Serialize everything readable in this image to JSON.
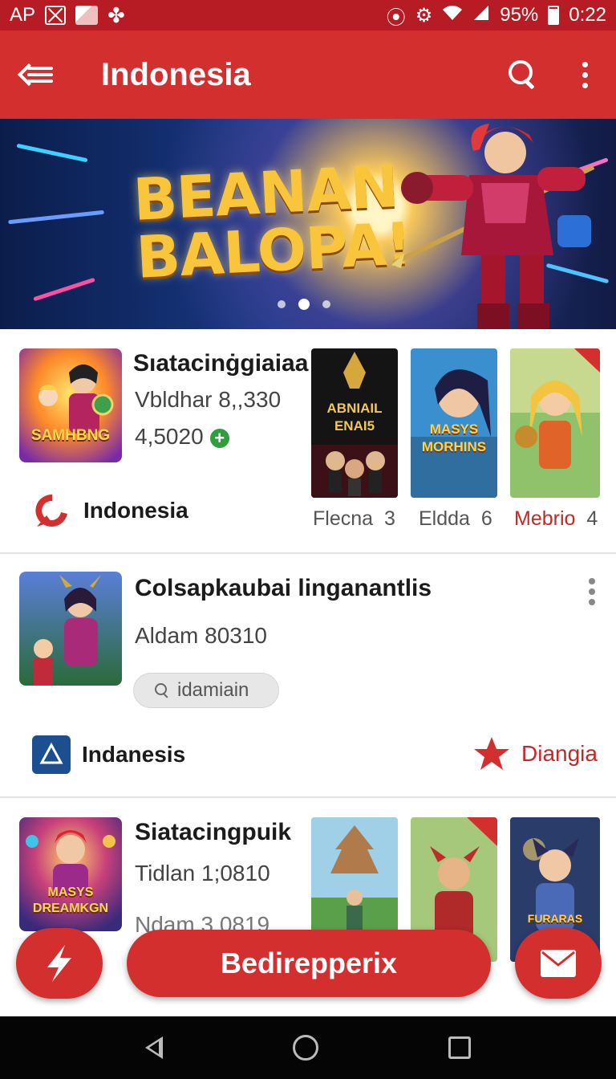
{
  "status_bar": {
    "carrier": "AP",
    "battery": "95%",
    "time": "0:22"
  },
  "app_bar": {
    "title": "Indonesia"
  },
  "banner": {
    "line1": "BEANAN",
    "line2": "BALOPA!",
    "dots": 3,
    "active_dot": 1
  },
  "cards": [
    {
      "thumb_text": "SAMHBNG",
      "name": "Sıatacinġgiaiaa",
      "line1": "Vbldhar 8,,330",
      "line2": "4,5020",
      "brand": "Indonesia",
      "posters": [
        {
          "art_text_1": "ABNIAIL",
          "art_text_2": "ENAI5",
          "label": "Flecna",
          "count": "3"
        },
        {
          "art_text_1": "MASYS",
          "art_text_2": "MORHINS",
          "label": "Eldda",
          "count": "6"
        },
        {
          "art_text_1": "",
          "art_text_2": "",
          "label": "Mebrio",
          "count": "4"
        }
      ]
    },
    {
      "name": "Colsapkaubai linganantlis",
      "line1": "Aldam 80310",
      "chip": "idamiain",
      "brand": "Indanesis",
      "rating_label": "Diangia"
    },
    {
      "thumb_text_1": "MASYS",
      "thumb_text_2": "DREAMKGN",
      "name": "Siatacingpuik",
      "line1": "Tidlan 1;0810",
      "line2": "Ndam 3,0819",
      "posters": [
        {
          "art_text": ""
        },
        {
          "art_text": ""
        },
        {
          "art_text": "FURARAS"
        }
      ]
    }
  ],
  "bottom": {
    "cta_label": "Bedirepperix"
  },
  "colors": {
    "primary": "#d32f2f",
    "status_bar": "#b71c25",
    "accent_red": "#c62828",
    "green": "#2e9f3a"
  }
}
